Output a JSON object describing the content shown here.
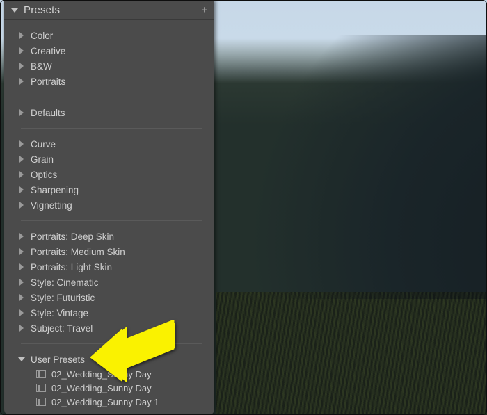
{
  "panel": {
    "title": "Presets",
    "add_tooltip": "+"
  },
  "groups": [
    {
      "items": [
        "Color",
        "Creative",
        "B&W",
        "Portraits"
      ]
    },
    {
      "items": [
        "Defaults"
      ]
    },
    {
      "items": [
        "Curve",
        "Grain",
        "Optics",
        "Sharpening",
        "Vignetting"
      ]
    },
    {
      "items": [
        "Portraits: Deep Skin",
        "Portraits: Medium Skin",
        "Portraits: Light Skin",
        "Style: Cinematic",
        "Style: Futuristic",
        "Style: Vintage",
        "Subject: Travel"
      ]
    }
  ],
  "user_presets": {
    "label": "User Presets",
    "items": [
      "02_Wedding_Sunny Day",
      "02_Wedding_Sunny Day",
      "02_Wedding_Sunny Day 1"
    ]
  }
}
